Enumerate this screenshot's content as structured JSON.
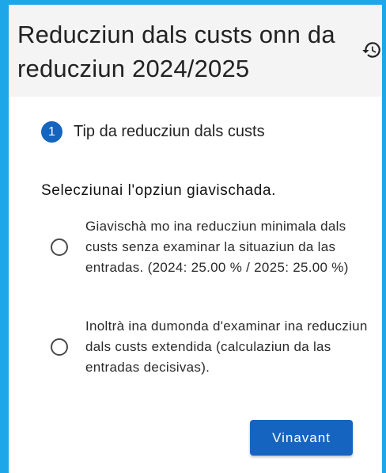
{
  "header": {
    "title": "Reducziun dals custs onn da reducziun 2024/2025",
    "history_icon": "history-icon"
  },
  "step": {
    "number": "1",
    "label": "Tip da reducziun dals custs"
  },
  "form": {
    "prompt": "Selecziunai l'opziun giavischada.",
    "options": [
      {
        "label": "Giavischà mo ina reducziun minimala dals custs senza examinar la situaziun da las entradas. (2024: 25.00 % / 2025: 25.00 %)",
        "selected": false
      },
      {
        "label": "Inoltrà ina dumonda d'examinar ina reducziun dals custs extendida (calculaziun da las entradas decisivas).",
        "selected": false
      }
    ]
  },
  "actions": {
    "next_label": "Vinavant"
  },
  "colors": {
    "frame": "#1ea7e8",
    "primary": "#1565c0",
    "header_bg": "#f4f4f4"
  }
}
